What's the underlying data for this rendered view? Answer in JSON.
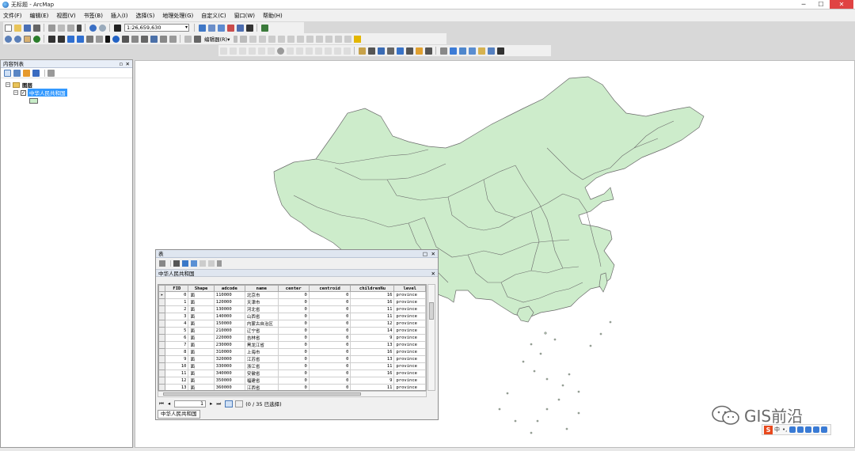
{
  "window": {
    "title": "无标题 - ArcMap",
    "min": "─",
    "max": "☐",
    "close": "✕"
  },
  "menu": [
    "文件(F)",
    "编辑(E)",
    "视图(V)",
    "书签(B)",
    "插入(I)",
    "选择(S)",
    "地理处理(G)",
    "自定义(C)",
    "窗口(W)",
    "帮助(H)"
  ],
  "toolbar": {
    "scale_value": "1:26,659,630",
    "editor_label": "编辑器(R)▾"
  },
  "toc": {
    "title": "内容列表",
    "group_label": "图层",
    "layer_label": "中华人民共和国"
  },
  "attribute_table": {
    "title": "表",
    "table_name": "中华人民共和国",
    "columns": [
      "FID",
      "Shape",
      "adcode",
      "name",
      "center",
      "centroid",
      "childrenNu",
      "level"
    ],
    "rows": [
      [
        "0",
        "面",
        "110000",
        "北京市",
        "0",
        "0",
        "16",
        "province"
      ],
      [
        "1",
        "面",
        "120000",
        "天津市",
        "0",
        "0",
        "16",
        "province"
      ],
      [
        "2",
        "面",
        "130000",
        "河北省",
        "0",
        "0",
        "11",
        "province"
      ],
      [
        "3",
        "面",
        "140000",
        "山西省",
        "0",
        "0",
        "11",
        "province"
      ],
      [
        "4",
        "面",
        "150000",
        "内蒙古自治区",
        "0",
        "0",
        "12",
        "province"
      ],
      [
        "5",
        "面",
        "210000",
        "辽宁省",
        "0",
        "0",
        "14",
        "province"
      ],
      [
        "6",
        "面",
        "220000",
        "吉林省",
        "0",
        "0",
        "9",
        "province"
      ],
      [
        "7",
        "面",
        "230000",
        "黑龙江省",
        "0",
        "0",
        "13",
        "province"
      ],
      [
        "8",
        "面",
        "310000",
        "上海市",
        "0",
        "0",
        "16",
        "province"
      ],
      [
        "9",
        "面",
        "320000",
        "江苏省",
        "0",
        "0",
        "13",
        "province"
      ],
      [
        "10",
        "面",
        "330000",
        "浙江省",
        "0",
        "0",
        "11",
        "province"
      ],
      [
        "11",
        "面",
        "340000",
        "安徽省",
        "0",
        "0",
        "16",
        "province"
      ],
      [
        "12",
        "面",
        "350000",
        "福建省",
        "0",
        "0",
        "9",
        "province"
      ],
      [
        "13",
        "面",
        "360000",
        "江西省",
        "0",
        "0",
        "11",
        "province"
      ],
      [
        "14",
        "面",
        "370000",
        "山东省",
        "0",
        "0",
        "16",
        "province"
      ]
    ],
    "page": "1",
    "selection_status": "(0 / 35 已选择)",
    "tab_label": "中华人民共和国"
  },
  "watermark": {
    "text": "GIS前沿"
  },
  "ime": {
    "brand": "S",
    "lang": "中",
    "punct": "•,"
  },
  "colors": {
    "land": "#cdeccb",
    "border": "#6b6b6b",
    "selection": "#3399ff"
  }
}
